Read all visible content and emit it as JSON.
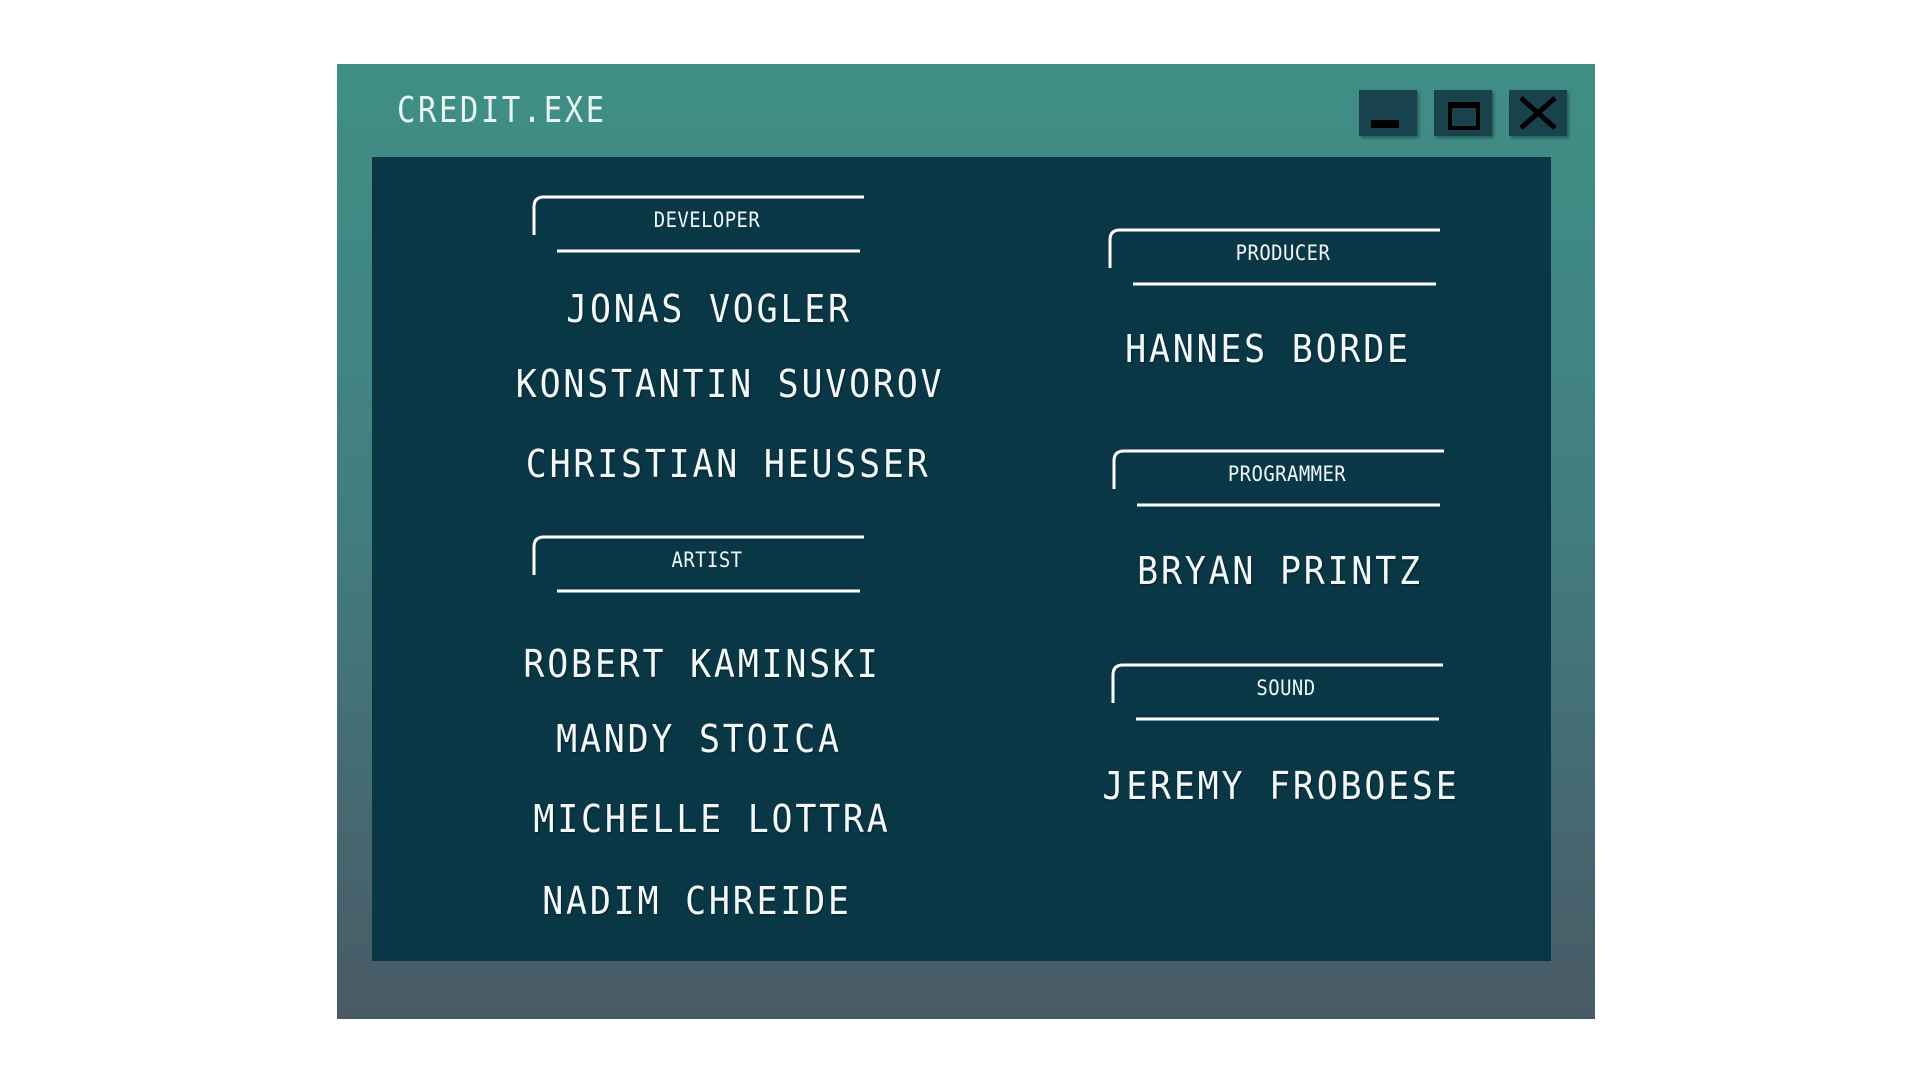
{
  "window": {
    "title": "CREDIT.EXE",
    "buttons": {
      "minimize_icon": "minimize-icon",
      "maximize_icon": "maximize-icon",
      "close_icon": "close-icon"
    },
    "colors": {
      "frame_top": "#3f8f86",
      "frame_bottom": "#485a66",
      "panel": "#0a3746",
      "button": "#18424c",
      "text": "#f2f7f7"
    }
  },
  "credits": {
    "developer": {
      "label": "DEVELOPER",
      "names": [
        "JONAS VOGLER",
        "KONSTANTIN SUVOROV",
        "CHRISTIAN HEUSSER"
      ]
    },
    "artist": {
      "label": "ARTIST",
      "names": [
        "ROBERT KAMINSKI",
        "MANDY STOICA",
        "MICHELLE LOTTRA",
        "NADIM CHREIDE"
      ]
    },
    "producer": {
      "label": "PRODUCER",
      "names": [
        "HANNES BORDE"
      ]
    },
    "programmer": {
      "label": "PROGRAMMER",
      "names": [
        "BRYAN PRINTZ"
      ]
    },
    "sound": {
      "label": "SOUND",
      "names": [
        "JEREMY FROBOESE"
      ]
    }
  }
}
